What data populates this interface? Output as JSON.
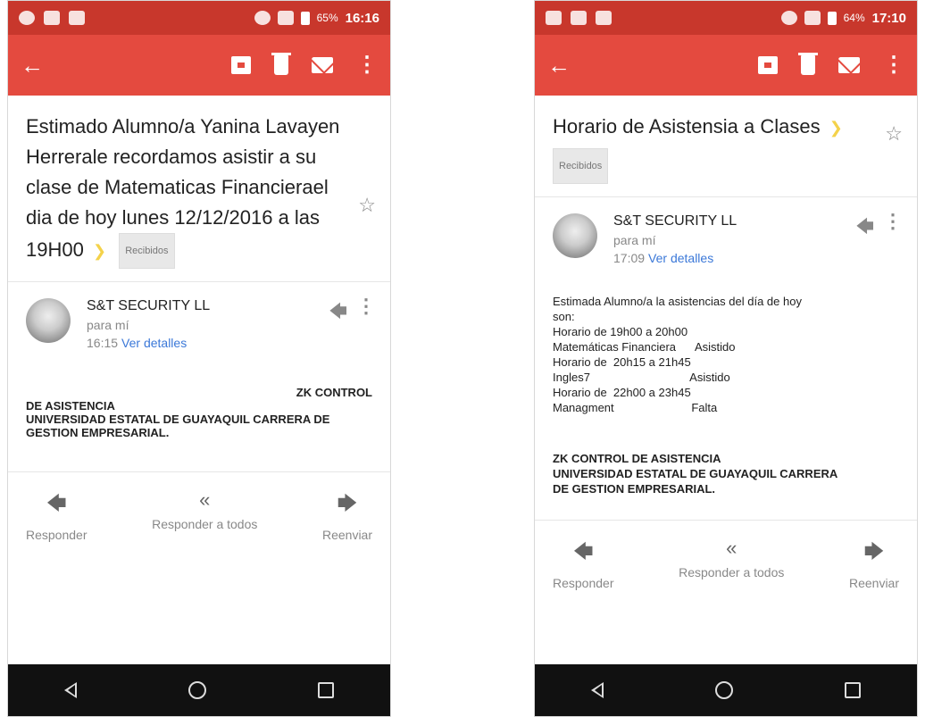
{
  "phone1": {
    "status": {
      "batpct": "65%",
      "time": "16:16"
    },
    "subject": "Estimado Alumno/a Yanina Lavayen Herrerale recordamos asistir a su clase de Matematicas Financierael dia de hoy lunes 12/12/2016 a las 19H00",
    "label": "Recibidos",
    "sender": {
      "name": "S&T SECURITY LL",
      "to": "para mí",
      "time": "16:15",
      "details": "Ver detalles"
    },
    "body": {
      "zk": "ZK CONTROL",
      "line1": "DE ASISTENCIA",
      "line2": "UNIVERSIDAD ESTATAL DE GUAYAQUIL CARRERA DE GESTION EMPRESARIAL."
    },
    "actions": {
      "reply": "Responder",
      "reply_all": "Responder a todos",
      "forward": "Reenviar"
    }
  },
  "phone2": {
    "status": {
      "batpct": "64%",
      "time": "17:10"
    },
    "subject": "Horario de Asistensia a Clases",
    "label": "Recibidos",
    "sender": {
      "name": "S&T SECURITY LL",
      "to": "para mí",
      "time": "17:09",
      "details": "Ver detalles"
    },
    "body_lines": [
      "Estimada Alumno/a la asistencias del día de hoy",
      "son:",
      "Horario de 19h00 a 20h00",
      "Matemáticas Financiera      Asistido",
      "Horario de  20h15 a 21h45",
      "Ingles7                               Asistido",
      "Horario de  22h00 a 23h45",
      "Managment                        Falta"
    ],
    "signature": {
      "line1": "ZK CONTROL DE ASISTENCIA",
      "line2": "UNIVERSIDAD ESTATAL DE GUAYAQUIL CARRERA",
      "line3": "DE GESTION EMPRESARIAL."
    },
    "actions": {
      "reply": "Responder",
      "reply_all": "Responder a todos",
      "forward": "Reenviar"
    }
  }
}
